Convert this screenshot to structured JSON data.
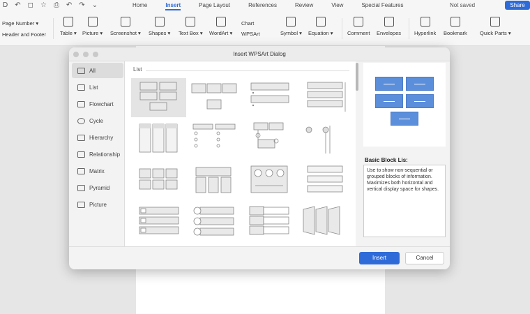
{
  "quick_icons": [
    "D",
    "↶",
    "◻",
    "☆",
    "⎙",
    "↶",
    "↷",
    "⌄"
  ],
  "ribbon": {
    "tabs": [
      "Home",
      "Insert",
      "Page Layout",
      "References",
      "Review",
      "View",
      "Special Features"
    ],
    "active_tab": "Insert",
    "status": "Not saved",
    "share": "Share"
  },
  "toolbar": {
    "page_number": "Page Number ▾",
    "header_footer": "Header and Footer",
    "items": [
      "Table ▾",
      "Picture ▾",
      "Screenshot ▾",
      "Shapes ▾",
      "Text Box ▾",
      "WordArt ▾",
      "Symbol ▾",
      "Equation ▾",
      "Comment",
      "Envelopes",
      "Hyperlink",
      "Bookmark",
      "Quick Parts ▾"
    ],
    "chart": "Chart",
    "wpsart": "WPSArt"
  },
  "dialog": {
    "title": "Insert WPSArt Dialog",
    "categories": [
      "All",
      "List",
      "Flowchart",
      "Cycle",
      "Hierarchy",
      "Relationship",
      "Matrix",
      "Pyramid",
      "Picture"
    ],
    "selected_category": "All",
    "gallery_label": "List",
    "preview_title": "Basic Block Lis:",
    "description": "Use to show non-sequential or grouped blocks of information. Maximizes both horizontal and vertical display space for shapes.",
    "insert": "Insert",
    "cancel": "Cancel"
  },
  "colors": {
    "accent": "#2f6bd8",
    "preview_fill": "#5b8edb"
  }
}
